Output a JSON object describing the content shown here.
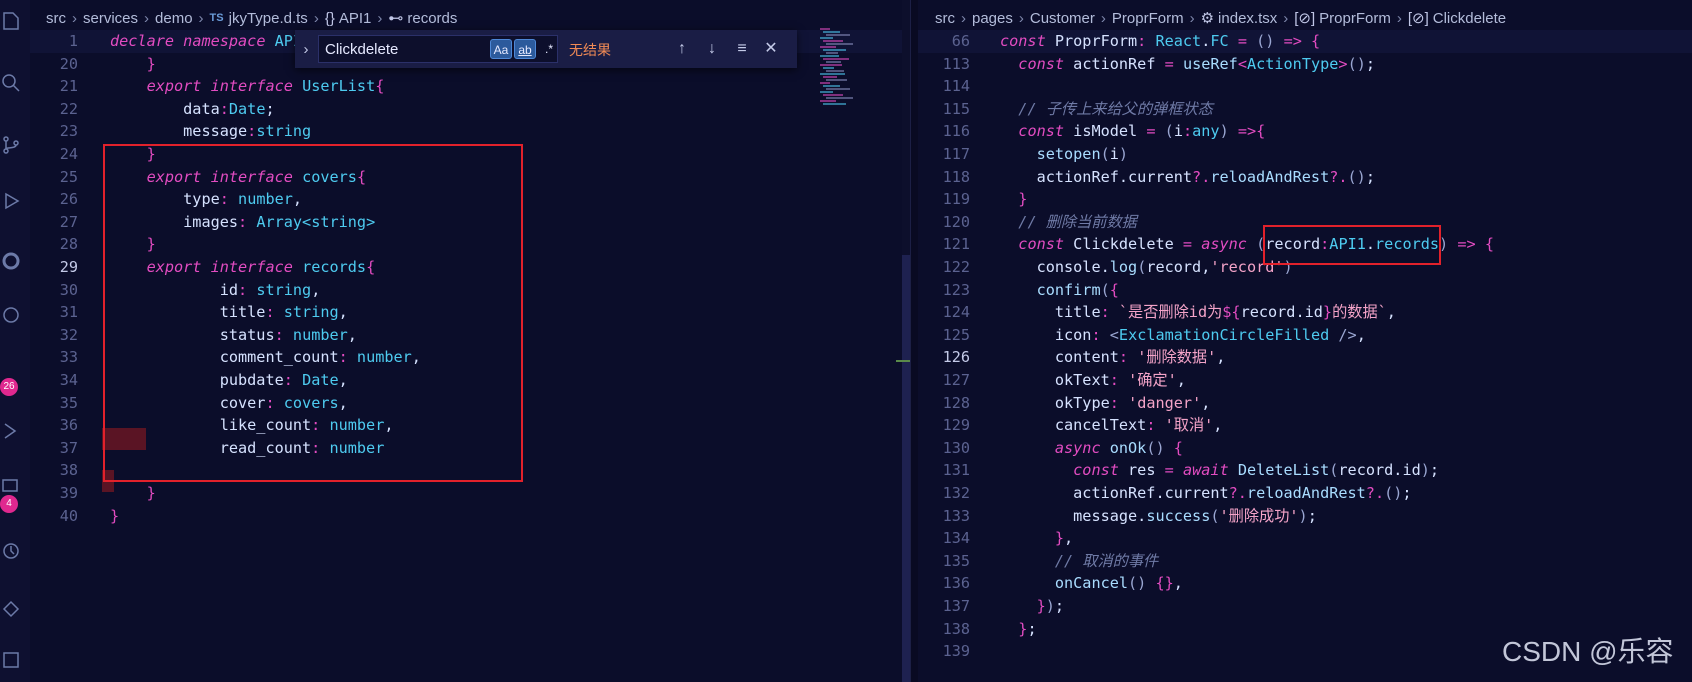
{
  "left_editor": {
    "breadcrumb": [
      "src",
      "services",
      "demo",
      "jkyType.d.ts",
      "API1",
      "records"
    ],
    "breadcrumb_ts_badge": "TS",
    "breadcrumb_ns_glyph": "{}",
    "breadcrumb_iface_glyph": "⊷",
    "lines": [
      {
        "n": "1",
        "html": "<span class=\"k\">declare</span> <span class=\"k\">namespace</span> <span class=\"t\">API</span>"
      },
      {
        "n": "20",
        "html": "    <span class=\"o\">}</span>"
      },
      {
        "n": "21",
        "html": "    <span class=\"k\">export</span> <span class=\"k\">interface</span> <span class=\"t\">UserList</span><span class=\"o\">{</span>"
      },
      {
        "n": "22",
        "html": "        <span class=\"v\">data</span><span class=\"o\">:</span><span class=\"t\">Date</span><span class=\"v\">;</span>"
      },
      {
        "n": "23",
        "html": "        <span class=\"v\">message</span><span class=\"o\">:</span><span class=\"t\">string</span>"
      },
      {
        "n": "24",
        "html": "    <span class=\"o\">}</span>"
      },
      {
        "n": "25",
        "html": "    <span class=\"k\">export</span> <span class=\"k\">interface</span> <span class=\"t\">covers</span><span class=\"o\">{</span>"
      },
      {
        "n": "26",
        "html": "        <span class=\"v\">type</span><span class=\"o\">:</span> <span class=\"t\">number</span><span class=\"v\">,</span>"
      },
      {
        "n": "27",
        "html": "        <span class=\"v\">images</span><span class=\"o\">:</span> <span class=\"t\">Array&lt;string&gt;</span>"
      },
      {
        "n": "28",
        "html": "    <span class=\"o\">}</span>"
      },
      {
        "n": "29",
        "html": "    <span class=\"k\">export</span> <span class=\"k\">interface</span> <span class=\"t\">records</span><span class=\"o\">{</span>"
      },
      {
        "n": "30",
        "html": "            <span class=\"v\">id</span><span class=\"o\">:</span> <span class=\"t\">string</span><span class=\"v\">,</span>"
      },
      {
        "n": "31",
        "html": "            <span class=\"v\">title</span><span class=\"o\">:</span> <span class=\"t\">string</span><span class=\"v\">,</span>"
      },
      {
        "n": "32",
        "html": "            <span class=\"v\">status</span><span class=\"o\">:</span> <span class=\"t\">number</span><span class=\"v\">,</span>"
      },
      {
        "n": "33",
        "html": "            <span class=\"v\">comment_count</span><span class=\"o\">:</span> <span class=\"t\">number</span><span class=\"v\">,</span>"
      },
      {
        "n": "34",
        "html": "            <span class=\"v\">pubdate</span><span class=\"o\">:</span> <span class=\"t\">Date</span><span class=\"v\">,</span>"
      },
      {
        "n": "35",
        "html": "            <span class=\"v\">cover</span><span class=\"o\">:</span> <span class=\"t\">covers</span><span class=\"v\">,</span>"
      },
      {
        "n": "36",
        "html": "            <span class=\"v\">like_count</span><span class=\"o\">:</span> <span class=\"t\">number</span><span class=\"v\">,</span>"
      },
      {
        "n": "37",
        "html": "            <span class=\"v\">read_count</span><span class=\"o\">:</span> <span class=\"t\">number</span>"
      },
      {
        "n": "38",
        "html": ""
      },
      {
        "n": "39",
        "html": "    <span class=\"o\">}</span>"
      },
      {
        "n": "40",
        "html": "<span class=\"o\">}</span>"
      }
    ],
    "active_line": "29"
  },
  "find_widget": {
    "query": "Clickdelete",
    "match_case": "Aa",
    "whole_word": "ab",
    "regex": ".*",
    "status": "无结果",
    "toggle_glyph": "›",
    "prev_glyph": "↑",
    "next_glyph": "↓",
    "selection_glyph": "≡",
    "close_glyph": "✕"
  },
  "right_editor": {
    "breadcrumb": [
      "src",
      "pages",
      "Customer",
      "ProprForm",
      "index.tsx",
      "ProprForm",
      "Clickdelete"
    ],
    "breadcrumb_var_glyph": "[⊘]",
    "lines": [
      {
        "n": "66",
        "html": "<span class=\"k\">const</span> <span class=\"v\">ProprForm</span><span class=\"o\">:</span> <span class=\"t\">React</span><span class=\"v\">.</span><span class=\"t\">FC</span> <span class=\"o\">=</span> <span class=\"p\">()</span> <span class=\"o\">=&gt;</span> <span class=\"o\">{</span>"
      },
      {
        "n": "113",
        "html": "  <span class=\"k\">const</span> <span class=\"v\">actionRef</span> <span class=\"o\">=</span> <span class=\"f\">useRef</span><span class=\"o\">&lt;</span><span class=\"t\">ActionType</span><span class=\"o\">&gt;</span><span class=\"p\">()</span><span class=\"v\">;</span>"
      },
      {
        "n": "114",
        "html": ""
      },
      {
        "n": "115",
        "html": "  <span class=\"c\">// 子传上来给父的弹框状态</span>"
      },
      {
        "n": "116",
        "html": "  <span class=\"k\">const</span> <span class=\"v\">isModel</span> <span class=\"o\">=</span> <span class=\"p\">(</span><span class=\"v\">i</span><span class=\"o\">:</span><span class=\"t\">any</span><span class=\"p\">)</span> <span class=\"o\">=&gt;{</span>"
      },
      {
        "n": "117",
        "html": "    <span class=\"f\">setopen</span><span class=\"p\">(</span><span class=\"v\">i</span><span class=\"p\">)</span>"
      },
      {
        "n": "118",
        "html": "    <span class=\"v\">actionRef</span><span class=\"v\">.</span><span class=\"v\">current</span><span class=\"o\">?.</span><span class=\"f\">reloadAndRest</span><span class=\"o\">?.</span><span class=\"p\">()</span><span class=\"v\">;</span>"
      },
      {
        "n": "119",
        "html": "  <span class=\"o\">}</span>"
      },
      {
        "n": "120",
        "html": "  <span class=\"c\">// 删除当前数据</span>"
      },
      {
        "n": "121",
        "html": "  <span class=\"k\">const</span> <span class=\"v\">Clickdelete</span> <span class=\"o\">=</span> <span class=\"k\">async</span> <span class=\"p\">(</span><span class=\"v\">record</span><span class=\"o\">:</span><span class=\"t\">API1</span><span class=\"v\">.</span><span class=\"t\">records</span><span class=\"p\">)</span> <span class=\"o\">=&gt;</span> <span class=\"o\">{</span>"
      },
      {
        "n": "122",
        "html": "    <span class=\"v\">console</span><span class=\"v\">.</span><span class=\"f\">log</span><span class=\"p\">(</span><span class=\"v\">record</span><span class=\"v\">,</span><span class=\"s\">'record'</span><span class=\"p\">)</span>"
      },
      {
        "n": "123",
        "html": "    <span class=\"f\">confirm</span><span class=\"p\">(</span><span class=\"o\">{</span>"
      },
      {
        "n": "124",
        "html": "      <span class=\"v\">title</span><span class=\"o\">:</span> <span class=\"s\">`是否删除id为</span><span class=\"o\">${</span><span class=\"v\">record</span><span class=\"v\">.</span><span class=\"v\">id</span><span class=\"o\">}</span><span class=\"s\">的数据`</span><span class=\"v\">,</span>"
      },
      {
        "n": "125",
        "html": "      <span class=\"v\">icon</span><span class=\"o\">:</span> <span class=\"p\">&lt;</span><span class=\"t\">ExclamationCircleFilled</span> <span class=\"p\">/&gt;</span><span class=\"v\">,</span>"
      },
      {
        "n": "126",
        "html": "      <span class=\"v\">content</span><span class=\"o\">:</span> <span class=\"s\">'删除数据'</span><span class=\"v\">,</span>"
      },
      {
        "n": "127",
        "html": "      <span class=\"v\">okText</span><span class=\"o\">:</span> <span class=\"s\">'确定'</span><span class=\"v\">,</span>"
      },
      {
        "n": "128",
        "html": "      <span class=\"v\">okType</span><span class=\"o\">:</span> <span class=\"s\">'danger'</span><span class=\"v\">,</span>"
      },
      {
        "n": "129",
        "html": "      <span class=\"v\">cancelText</span><span class=\"o\">:</span> <span class=\"s\">'取消'</span><span class=\"v\">,</span>"
      },
      {
        "n": "130",
        "html": "      <span class=\"k\">async</span> <span class=\"f\">onOk</span><span class=\"p\">()</span> <span class=\"o\">{</span>"
      },
      {
        "n": "131",
        "html": "        <span class=\"k\">const</span> <span class=\"v\">res</span> <span class=\"o\">=</span> <span class=\"k\">await</span> <span class=\"f\">DeleteList</span><span class=\"p\">(</span><span class=\"v\">record</span><span class=\"v\">.</span><span class=\"v\">id</span><span class=\"p\">)</span><span class=\"v\">;</span>"
      },
      {
        "n": "132",
        "html": "        <span class=\"v\">actionRef</span><span class=\"v\">.</span><span class=\"v\">current</span><span class=\"o\">?.</span><span class=\"f\">reloadAndRest</span><span class=\"o\">?.</span><span class=\"p\">()</span><span class=\"v\">;</span>"
      },
      {
        "n": "133",
        "html": "        <span class=\"v\">message</span><span class=\"v\">.</span><span class=\"f\">success</span><span class=\"p\">(</span><span class=\"s\">'删除成功'</span><span class=\"p\">)</span><span class=\"v\">;</span>"
      },
      {
        "n": "134",
        "html": "      <span class=\"o\">}</span><span class=\"v\">,</span>"
      },
      {
        "n": "135",
        "html": "      <span class=\"c\">// 取消的事件</span>"
      },
      {
        "n": "136",
        "html": "      <span class=\"f\">onCancel</span><span class=\"p\">()</span> <span class=\"o\">{}</span><span class=\"v\">,</span>"
      },
      {
        "n": "137",
        "html": "    <span class=\"o\">}</span><span class=\"p\">)</span><span class=\"v\">;</span>"
      },
      {
        "n": "138",
        "html": "  <span class=\"o\">}</span><span class=\"v\">;</span>"
      },
      {
        "n": "139",
        "html": ""
      }
    ],
    "active_line": "126"
  },
  "activity_bar": {
    "icons": [
      "explorer-icon",
      "search-icon",
      "source-control-icon",
      "run-debug-icon",
      "extensions-icon",
      "remote-icon",
      "testing-icon",
      "chat-icon",
      "timeline-icon",
      "accounts-icon"
    ],
    "badges": [
      "26",
      "4"
    ]
  },
  "watermark": "CSDN @乐容",
  "colors": {
    "keyword": "#e24cc1",
    "type": "#4ecbf0",
    "string": "#f4a3c8",
    "comment": "#6f7aa6",
    "highlight_box": "#e2212b"
  }
}
